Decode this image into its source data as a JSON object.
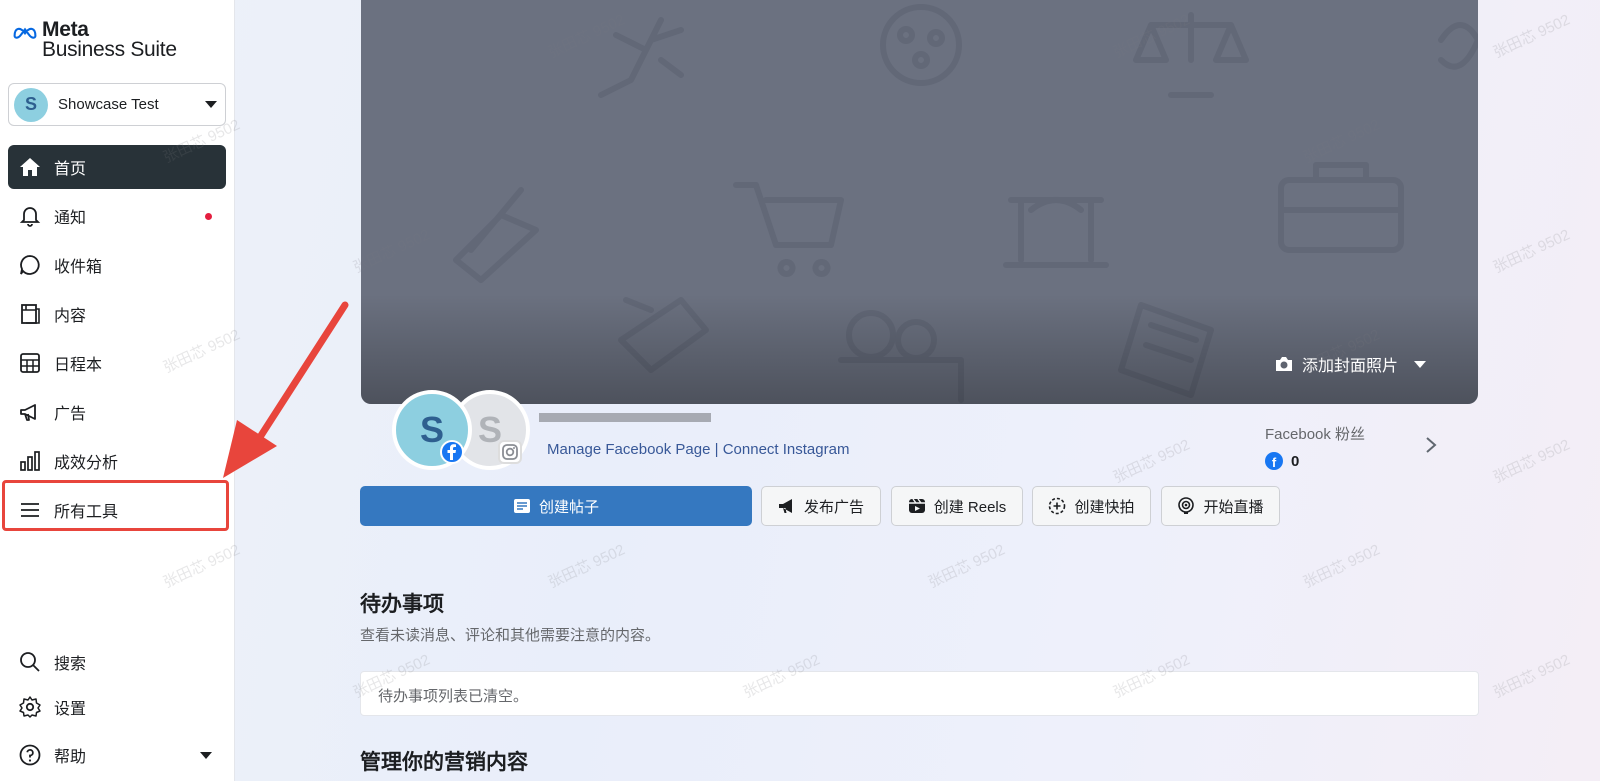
{
  "app": {
    "brand_line1": "Meta",
    "brand_line2": "Business Suite"
  },
  "account": {
    "initial": "S",
    "name": "Showcase Test"
  },
  "sidebar": {
    "items": [
      {
        "label": "首页",
        "icon": "home-icon",
        "active": true
      },
      {
        "label": "通知",
        "icon": "bell-icon",
        "has_dot": true
      },
      {
        "label": "收件箱",
        "icon": "chat-bubble-icon"
      },
      {
        "label": "内容",
        "icon": "content-icon"
      },
      {
        "label": "日程本",
        "icon": "calendar-grid-icon"
      },
      {
        "label": "广告",
        "icon": "megaphone-icon"
      },
      {
        "label": "成效分析",
        "icon": "bar-chart-icon"
      },
      {
        "label": "所有工具",
        "icon": "menu-icon",
        "highlighted": true
      }
    ],
    "bottom": [
      {
        "label": "搜索",
        "icon": "search-icon"
      },
      {
        "label": "设置",
        "icon": "gear-icon"
      },
      {
        "label": "帮助",
        "icon": "help-icon"
      }
    ]
  },
  "cover": {
    "add_cover_label": "添加封面照片"
  },
  "profile": {
    "fb_initial": "S",
    "ig_initial": "S",
    "manage_link": "Manage Facebook Page",
    "separator": "|",
    "connect_link": "Connect Instagram",
    "fans_label": "Facebook 粉丝",
    "fans_count": "0"
  },
  "actions": {
    "create_post": "创建帖子",
    "publish_ad": "发布广告",
    "create_reels": "创建 Reels",
    "create_story": "创建快拍",
    "go_live": "开始直播"
  },
  "todo": {
    "title": "待办事项",
    "subtitle": "查看未读消息、评论和其他需要注意的内容。",
    "empty_text": "待办事项列表已清空。"
  },
  "marketing": {
    "title": "管理你的营销内容"
  },
  "colors": {
    "accent": "#3578c0",
    "active_nav": "#283238",
    "highlight": "#e8453c",
    "notification_dot": "#e41e3f"
  },
  "watermark_text": "张田芯 9502"
}
